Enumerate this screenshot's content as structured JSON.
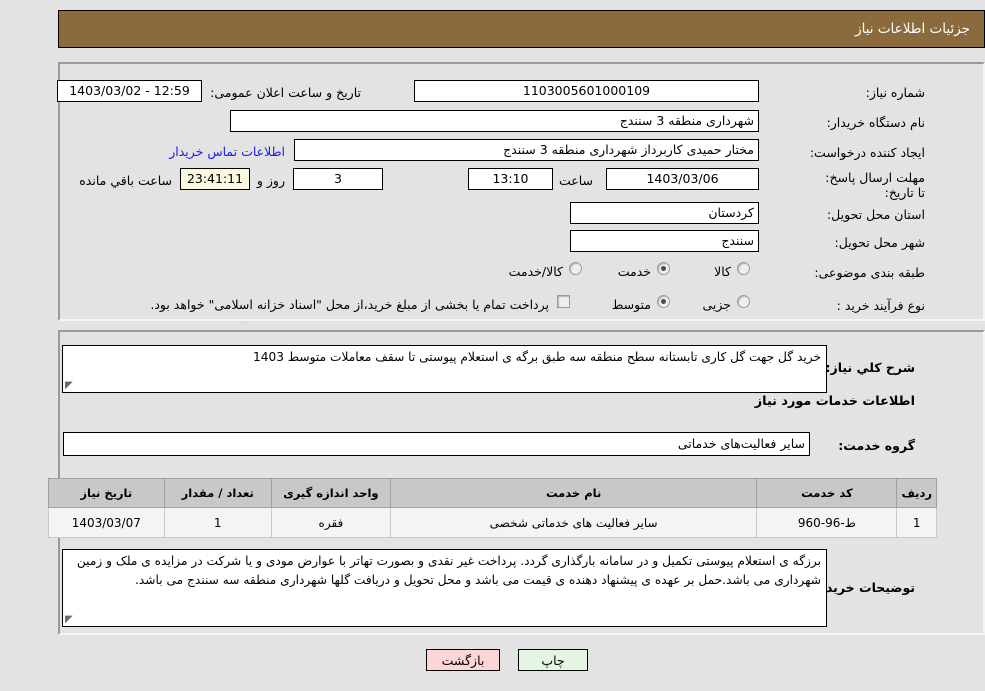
{
  "header": {
    "title": "جزئیات اطلاعات نیاز"
  },
  "form": {
    "need_number": {
      "label": "شماره نیاز:",
      "value": "1103005601000109"
    },
    "public_announce": {
      "label": "تاریخ و ساعت اعلان عمومی:",
      "value": "12:59 - 1403/03/02"
    },
    "buyer_org": {
      "label": "نام دستگاه خریدار:",
      "value": "شهرداری منطقه 3 سنندج"
    },
    "request_creator": {
      "label": "ایجاد کننده درخواست:",
      "value": "مختار حمیدی کاربرداز شهرداری منطقه 3 سنندج"
    },
    "buyer_contact_link": "اطلاعات تماس خریدار",
    "deadline": {
      "label": "مهلت ارسال پاسخ: تا تاریخ:",
      "date": "1403/03/06",
      "time_label": "ساعت",
      "time": "13:10",
      "days": "3",
      "days_label": "روز و",
      "countdown": "23:41:11",
      "countdown_label": "ساعت باقي مانده"
    },
    "province": {
      "label": "استان محل تحویل:",
      "value": "کردستان"
    },
    "city": {
      "label": "شهر محل تحویل:",
      "value": "سنندج"
    },
    "category": {
      "label": "طبقه بندی موضوعی:",
      "options": [
        "کالا",
        "خدمت",
        "کالا/خدمت"
      ],
      "selected": "خدمت"
    },
    "purchase_type": {
      "label": "نوع فرآیند خرید :",
      "options": [
        "جزیی",
        "متوسط"
      ],
      "selected": "متوسط",
      "checkbox_label": "پرداخت تمام یا بخشی از مبلغ خرید،از محل \"اسناد خزانه اسلامی\" خواهد بود.",
      "checkbox_checked": false
    }
  },
  "summary": {
    "label": "شرح کلي نياز:",
    "value": "خرید گل جهت گل کاری تابستانه سطح منطقه سه طبق برگه ی استعلام پیوستی تا سقف معاملات متوسط 1403"
  },
  "services_section": {
    "heading": "اطلاعات خدمات مورد نیاز",
    "group_label": "گروه خدمت:",
    "group_value": "سایر فعالیت‌های خدماتی"
  },
  "table": {
    "headers": [
      "ردیف",
      "کد خدمت",
      "نام خدمت",
      "واحد اندازه گیری",
      "تعداد / مقدار",
      "تاریخ نیاز"
    ],
    "rows": [
      {
        "radif": "1",
        "code": "ط-96-960",
        "name": "سایر فعالیت های خدماتی شخصی",
        "unit": "فقره",
        "qty": "1",
        "date": "1403/03/07"
      }
    ]
  },
  "buyer_notes": {
    "label": "توضیحات خریدار:",
    "value": "برزگه ی استعلام پیوستی تکمیل و در سامانه بارگذاری گردد. پرداخت غیر نقدی و بصورت تهاتر با عوارض مودی و یا شرکت در مزایده ی ملک و زمین شهرداری می باشد.حمل بر عهده ی پیشنهاد دهنده ی قیمت می باشد و محل تحویل و دریافت گلها شهرداری منطقه سه سنندج می باشد."
  },
  "footer": {
    "back_label": "بازگشت",
    "print_label": "چاپ"
  },
  "watermark": {
    "text": "AriaTender.net"
  },
  "colors": {
    "header_bg": "#8b6b3d",
    "page_bg": "#e3e3e3",
    "link": "#1a1ae6",
    "back_btn": "#fdd5d5",
    "print_btn": "#e4f5e4",
    "countdown_bg": "#fbf8df",
    "table_header_bg": "#c8c8c8"
  }
}
